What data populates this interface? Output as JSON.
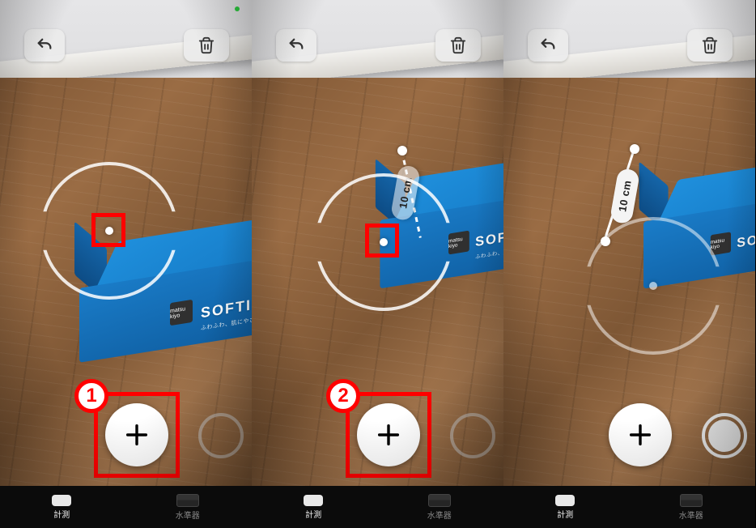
{
  "tabs": {
    "measure": "計測",
    "level": "水準器"
  },
  "product": {
    "brand_full": "SOFTIM",
    "brand_cut": "SOFTI",
    "logo": "matsu kiyo",
    "subtitle": "ふわふわ、肌にやさしい"
  },
  "measurement": {
    "label_panel2": "10 cm",
    "label_panel3": "10 cm"
  },
  "annotations": {
    "badge1": "1",
    "badge2": "2"
  },
  "icons": {
    "undo": "undo-icon",
    "trash": "trash-icon",
    "add": "plus-icon",
    "shutter": "shutter-icon",
    "center_dot": "center-dot-icon"
  }
}
